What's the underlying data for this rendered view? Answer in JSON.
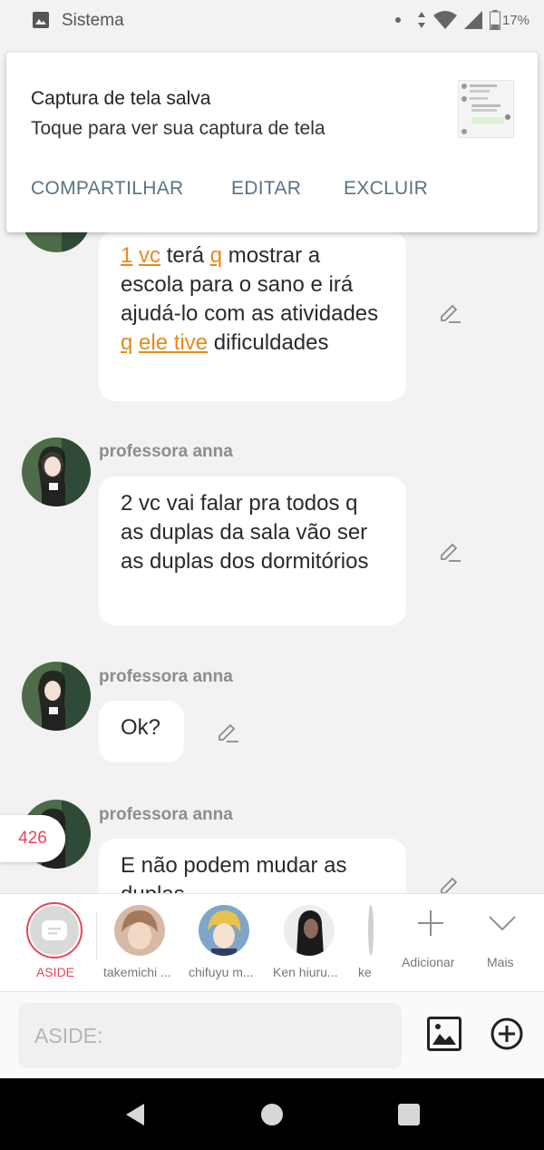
{
  "status_bar": {
    "app_name": "Sistema",
    "battery": "17%"
  },
  "notification": {
    "title": "Captura de tela salva",
    "text": "Toque para ver sua captura de tela",
    "actions": [
      "COMPARTILHAR",
      "EDITAR",
      "EXCLUIR"
    ]
  },
  "messages": [
    {
      "sender": "",
      "parts": [
        {
          "t": "1",
          "hl": true
        },
        {
          "t": " ",
          "hl": false
        },
        {
          "t": "vc",
          "hl": true
        },
        {
          "t": " terá ",
          "hl": false
        },
        {
          "t": "q",
          "hl": true
        },
        {
          "t": " mostrar a escola para o sano e irá ajudá-lo com as atividades ",
          "hl": false
        },
        {
          "t": "q",
          "hl": true
        },
        {
          "t": " ",
          "hl": false
        },
        {
          "t": "ele tive",
          "hl": true
        },
        {
          "t": " dificuldades",
          "hl": false
        }
      ]
    },
    {
      "sender": "professora anna",
      "text": "2 vc vai falar pra todos q as duplas da sala vão ser as duplas dos dormitórios"
    },
    {
      "sender": "professora anna",
      "text": "Ok?"
    },
    {
      "sender": "professora anna",
      "text": "E não podem mudar as duplas"
    }
  ],
  "unread_badge": "426",
  "participants": {
    "aside_label": "ASIDE",
    "items": [
      {
        "name": "takemichi ..."
      },
      {
        "name": "chifuyu m..."
      },
      {
        "name": "Ken hiuru..."
      },
      {
        "name": "ke"
      }
    ],
    "add_label": "Adicionar",
    "more_label": "Mais"
  },
  "input": {
    "placeholder": "ASIDE:"
  },
  "icons": {
    "status": [
      "image-icon",
      "dot-icon",
      "data-arrows-icon",
      "wifi-icon",
      "signal-icon",
      "battery-icon"
    ],
    "edit": "pencil-icon",
    "gallery": "gallery-icon",
    "add": "plus-circle-icon",
    "nav": [
      "back-icon",
      "home-icon",
      "recents-icon"
    ]
  },
  "colors": {
    "accent": "#e8445b",
    "highlight": "#e8891c",
    "action": "#5a7384"
  }
}
